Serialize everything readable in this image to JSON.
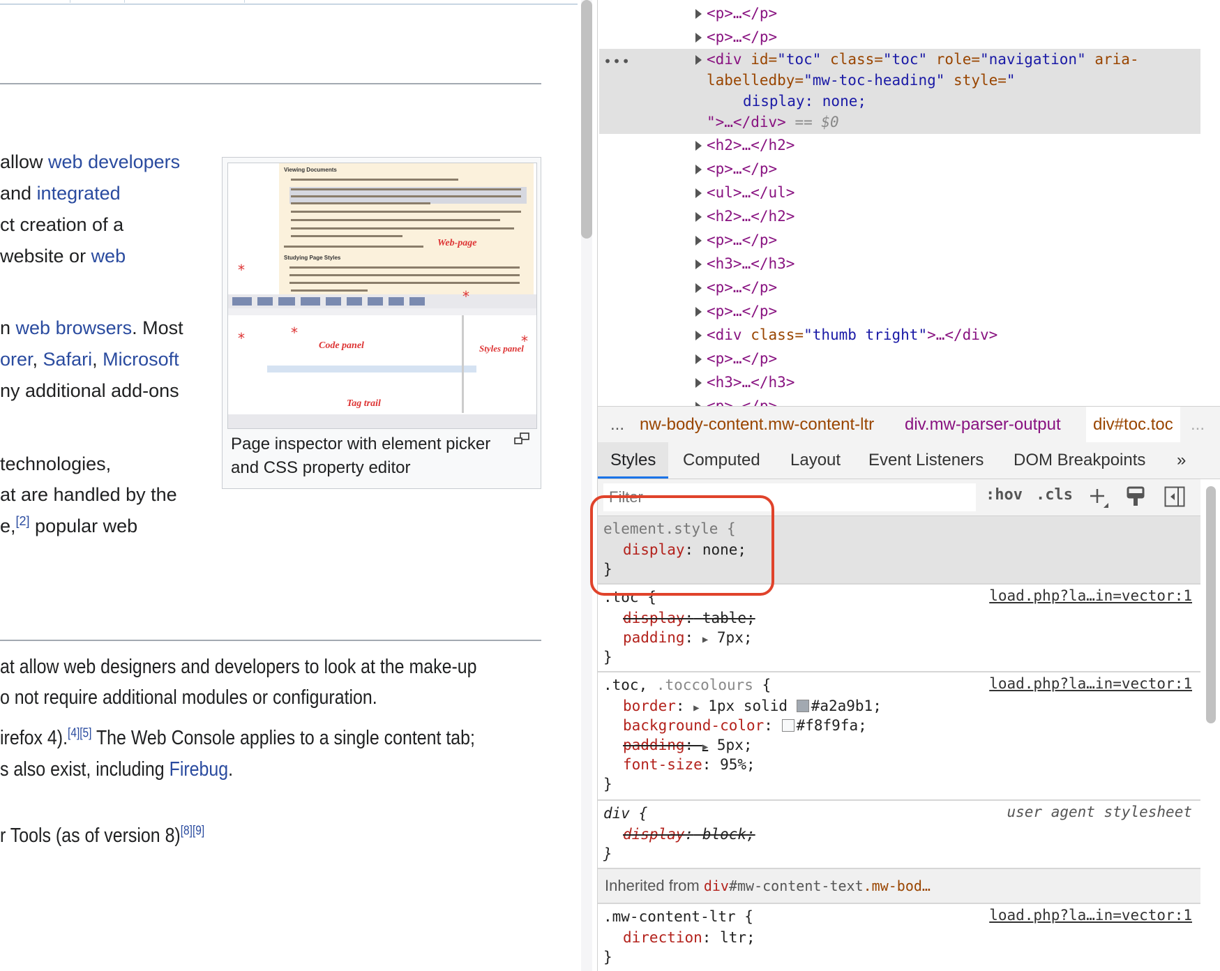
{
  "article": {
    "lines_top": [
      {
        "parts": [
          {
            "t": "allow "
          },
          {
            "t": "web developers",
            "link": true
          }
        ]
      },
      {
        "parts": [
          {
            "t": "and "
          },
          {
            "t": "integrated",
            "link": true
          }
        ]
      },
      {
        "parts": [
          {
            "t": "ct creation of a"
          }
        ]
      },
      {
        "parts": [
          {
            "t": "website or "
          },
          {
            "t": "web",
            "link": true
          }
        ]
      },
      {
        "parts": [
          {
            "t": "n "
          },
          {
            "t": "web browsers",
            "link": true
          },
          {
            "t": ". Most"
          }
        ]
      },
      {
        "parts": [
          {
            "t": "orer",
            "link": true
          },
          {
            "t": ", "
          },
          {
            "t": "Safari",
            "link": true
          },
          {
            "t": ", "
          },
          {
            "t": "Microsoft",
            "link": true
          }
        ]
      },
      {
        "parts": [
          {
            "t": "ny additional add-ons"
          }
        ]
      },
      {
        "parts": [
          {
            "t": " technologies,"
          }
        ]
      },
      {
        "parts": [
          {
            "t": "at are handled by the"
          }
        ]
      },
      {
        "parts": [
          {
            "t": "e,"
          },
          {
            "t": "[2]",
            "sup": true
          },
          {
            "t": " popular web"
          }
        ]
      }
    ],
    "lines_bottom": [
      {
        "parts": [
          {
            "t": "at allow web designers and developers to look at the make-up"
          }
        ]
      },
      {
        "parts": [
          {
            "t": "o not require additional modules or configuration."
          }
        ]
      },
      {
        "parts": [
          {
            "t": "irefox 4)."
          },
          {
            "t": "[4]",
            "sup": true
          },
          {
            "t": "[5]",
            "sup": true
          },
          {
            "t": " The Web Console applies to a single content tab;"
          }
        ]
      },
      {
        "parts": [
          {
            "t": "s also exist, including "
          },
          {
            "t": "Firebug",
            "link": true
          },
          {
            "t": "."
          }
        ]
      },
      {
        "parts": [
          {
            "t": "r Tools (as of version 8)"
          },
          {
            "t": "[8]",
            "sup": true
          },
          {
            "t": "[9]",
            "sup": true
          }
        ]
      }
    ],
    "thumb": {
      "caption": "Page inspector with element picker and CSS property editor",
      "image_labels": [
        "Web-page",
        "Code panel",
        "Tag trail",
        "Styles panel"
      ],
      "image_headings": [
        "Viewing Documents",
        "Studying Page Styles"
      ]
    }
  },
  "devtools": {
    "dom_nodes": [
      {
        "html": "<p>…</p>"
      },
      {
        "html": "<p>…</p>"
      },
      {
        "selected": true
      },
      {
        "html": "<h2>…</h2>"
      },
      {
        "html": "<p>…</p>"
      },
      {
        "html": "<ul>…</ul>"
      },
      {
        "html": "<h2>…</h2>"
      },
      {
        "html": "<p>…</p>"
      },
      {
        "html": "<h3>…</h3>"
      },
      {
        "html": "<p>…</p>"
      },
      {
        "html": "<p>…</p>"
      },
      {
        "html": "<div class=\"thumb tright\">…</div>"
      },
      {
        "html": "<p>…</p>"
      },
      {
        "html": "<h3>…</h3>"
      },
      {
        "html": "<p>…</p>"
      }
    ],
    "selected_node": {
      "tag_open": "<div",
      "id_attr": "id=",
      "id_val": "\"toc\"",
      "class_attr": "class=",
      "class_val": "\"toc\"",
      "role_attr": "role=",
      "role_val": "\"navigation\"",
      "aria_attr_1": "aria-",
      "aria_attr_2": "labelledby=",
      "aria_val": "\"mw-toc-heading\"",
      "style_attr": "style=",
      "style_open": "\"",
      "style_val": "display: none;",
      "close": "\">…</div>",
      "eq": "== $0",
      "dots": "•••"
    },
    "breadcrumbs": {
      "leading": "...",
      "items": [
        "nw-body-content.mw-content-ltr",
        "div.mw-parser-output",
        "div#toc.toc"
      ],
      "trailing": "..."
    },
    "tabs": [
      "Styles",
      "Computed",
      "Layout",
      "Event Listeners",
      "DOM Breakpoints",
      "»"
    ],
    "active_tab": "Styles",
    "filter": {
      "placeholder": "Filter",
      "hov": ":hov",
      "cls": ".cls"
    },
    "rules": {
      "element_style": {
        "selector": "element.style {",
        "prop": "display",
        "value": " none;",
        "close": "}"
      },
      "toc": {
        "selector": ".toc {",
        "source": "load.php?la…in=vector:1",
        "p1": "display",
        "v1": " table;",
        "p2": "padding",
        "v2": "7px;",
        "close": "}"
      },
      "toc_colours": {
        "selector_a": ".toc, ",
        "selector_b": ".toccolours",
        "selector_c": " {",
        "source": "load.php?la…in=vector:1",
        "p1": "border",
        "v1": "1px solid ",
        "c1": "#a2a9b1",
        "v1b": "#a2a9b1;",
        "p2": "background-color",
        "c2": "#f8f9fa",
        "v2": "#f8f9fa;",
        "p3": "padding",
        "v3": "5px;",
        "p4": "font-size",
        "v4": " 95%;",
        "close": "}"
      },
      "div": {
        "selector": "div {",
        "source": "user agent stylesheet",
        "p1": "display",
        "v1": " block;",
        "close": "}"
      },
      "inherited": {
        "label": "Inherited from ",
        "tag": "div",
        "id": "#mw-content-text",
        "cls": ".mw-bod…"
      },
      "mw_content_ltr": {
        "selector": ".mw-content-ltr {",
        "source": "load.php?la…in=vector:1",
        "p1": "direction",
        "v1": " ltr;",
        "close": "}"
      }
    }
  }
}
